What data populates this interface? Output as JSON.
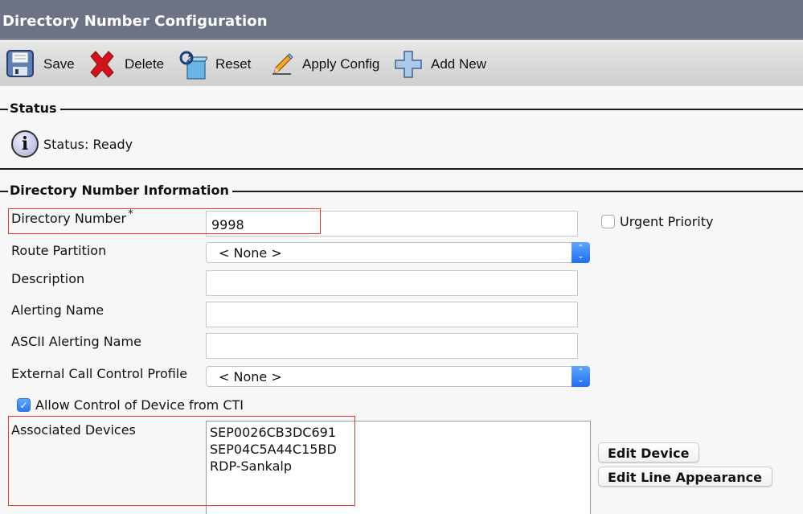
{
  "header": {
    "title": "Directory Number Configuration"
  },
  "toolbar": {
    "save_label": "Save",
    "delete_label": "Delete",
    "reset_label": "Reset",
    "apply_config_label": "Apply Config",
    "add_new_label": "Add New"
  },
  "status_section": {
    "legend": "Status",
    "text": "Status: Ready",
    "icon": "info-icon"
  },
  "dn_section": {
    "legend": "Directory Number Information",
    "directory_number": {
      "label": "Directory Number",
      "required_mark": "*",
      "value": "9998"
    },
    "urgent_priority": {
      "label": "Urgent Priority",
      "checked": false
    },
    "route_partition": {
      "label": "Route Partition",
      "selected": "< None >"
    },
    "description": {
      "label": "Description",
      "value": ""
    },
    "alerting_name": {
      "label": "Alerting Name",
      "value": ""
    },
    "ascii_alerting_name": {
      "label": "ASCII Alerting Name",
      "value": ""
    },
    "external_call_control_profile": {
      "label": "External Call Control Profile",
      "selected": "< None >"
    },
    "allow_cti": {
      "label": "Allow Control of Device from CTI",
      "checked": true
    },
    "associated_devices": {
      "label": "Associated Devices",
      "items": [
        "SEP0026CB3DC691",
        "SEP04C5A44C15BD",
        "RDP-Sankalp"
      ]
    },
    "edit_device_label": "Edit Device",
    "edit_line_appearance_label": "Edit Line Appearance"
  },
  "colors": {
    "header_bg": "#6b7385",
    "highlight_box": "#e2392c",
    "select_arrow": "#2a7cf4"
  }
}
